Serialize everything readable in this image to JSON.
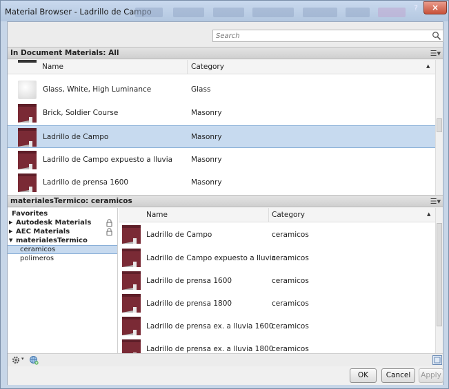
{
  "window": {
    "title": "Material Browser - Ladrillo de Campo",
    "help": "?",
    "close": "×"
  },
  "search": {
    "placeholder": "Search"
  },
  "document_panel": {
    "header": "In Document Materials: All",
    "columns": {
      "name": "Name",
      "category": "Category"
    },
    "rows": [
      {
        "name": "Glass, White, High Luminance",
        "category": "Glass",
        "swatch": "white"
      },
      {
        "name": "Brick, Soldier Course",
        "category": "Masonry",
        "swatch": "brick"
      },
      {
        "name": "Ladrillo de Campo",
        "category": "Masonry",
        "swatch": "brick",
        "selected": true
      },
      {
        "name": "Ladrillo de Campo expuesto a lluvia",
        "category": "Masonry",
        "swatch": "brick"
      },
      {
        "name": "Ladrillo de prensa 1600",
        "category": "Masonry",
        "swatch": "brick"
      }
    ]
  },
  "library_panel": {
    "header": "materialesTermico: ceramicos",
    "tree": [
      {
        "label": "Favorites",
        "bold": true,
        "arrow": ""
      },
      {
        "label": "Autodesk Materials",
        "bold": true,
        "arrow": "▶",
        "locked": true
      },
      {
        "label": "AEC Materials",
        "bold": true,
        "arrow": "▶",
        "locked": true
      },
      {
        "label": "materialesTermico",
        "bold": true,
        "arrow": "▼"
      },
      {
        "label": "ceramicos",
        "bold": false,
        "arrow": "",
        "selected": true
      },
      {
        "label": "polimeros",
        "bold": false,
        "arrow": ""
      }
    ],
    "columns": {
      "name": "Name",
      "category": "Category"
    },
    "rows": [
      {
        "name": "Ladrillo de Campo",
        "category": "ceramicos"
      },
      {
        "name": "Ladrillo de Campo expuesto a lluvia",
        "category": "ceramicos"
      },
      {
        "name": "Ladrillo de prensa 1600",
        "category": "ceramicos"
      },
      {
        "name": "Ladrillo de prensa 1800",
        "category": "ceramicos"
      },
      {
        "name": "Ladrillo de prensa ex. a lluvia 1600",
        "category": "ceramicos"
      },
      {
        "name": "Ladrillo de prensa ex. a lluvia 1800",
        "category": "ceramicos"
      }
    ]
  },
  "icons": {
    "search": "magnifier-icon",
    "view": "list-view-icon",
    "lock": "lock-icon",
    "gear": "gear-icon",
    "add_library": "globe-add-icon",
    "toggle_editor": "panel-toggle-icon"
  },
  "colors": {
    "selection": "#c7daef",
    "brick": "#7a2a35",
    "titlebar": "#c9d9ee"
  },
  "buttons": {
    "ok": "OK",
    "cancel": "Cancel",
    "apply": "Apply"
  }
}
